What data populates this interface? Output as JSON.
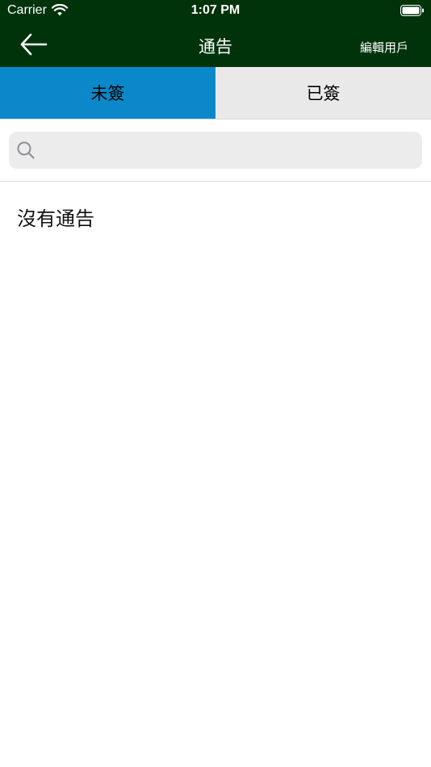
{
  "status_bar": {
    "carrier": "Carrier",
    "time": "1:07 PM",
    "wifi_icon": "wifi-icon",
    "battery_icon": "battery-icon"
  },
  "nav": {
    "title": "通告",
    "edit_label": "編輯用戶",
    "back_icon": "arrow-left-icon",
    "background": "#00330a"
  },
  "tabs": [
    {
      "label": "未簽",
      "active": true,
      "color": "#0a88c9"
    },
    {
      "label": "已簽",
      "active": false,
      "color": "#e9e9e9"
    }
  ],
  "search": {
    "placeholder": "",
    "value": "",
    "icon": "search-icon"
  },
  "content": {
    "empty_message": "沒有通告"
  }
}
